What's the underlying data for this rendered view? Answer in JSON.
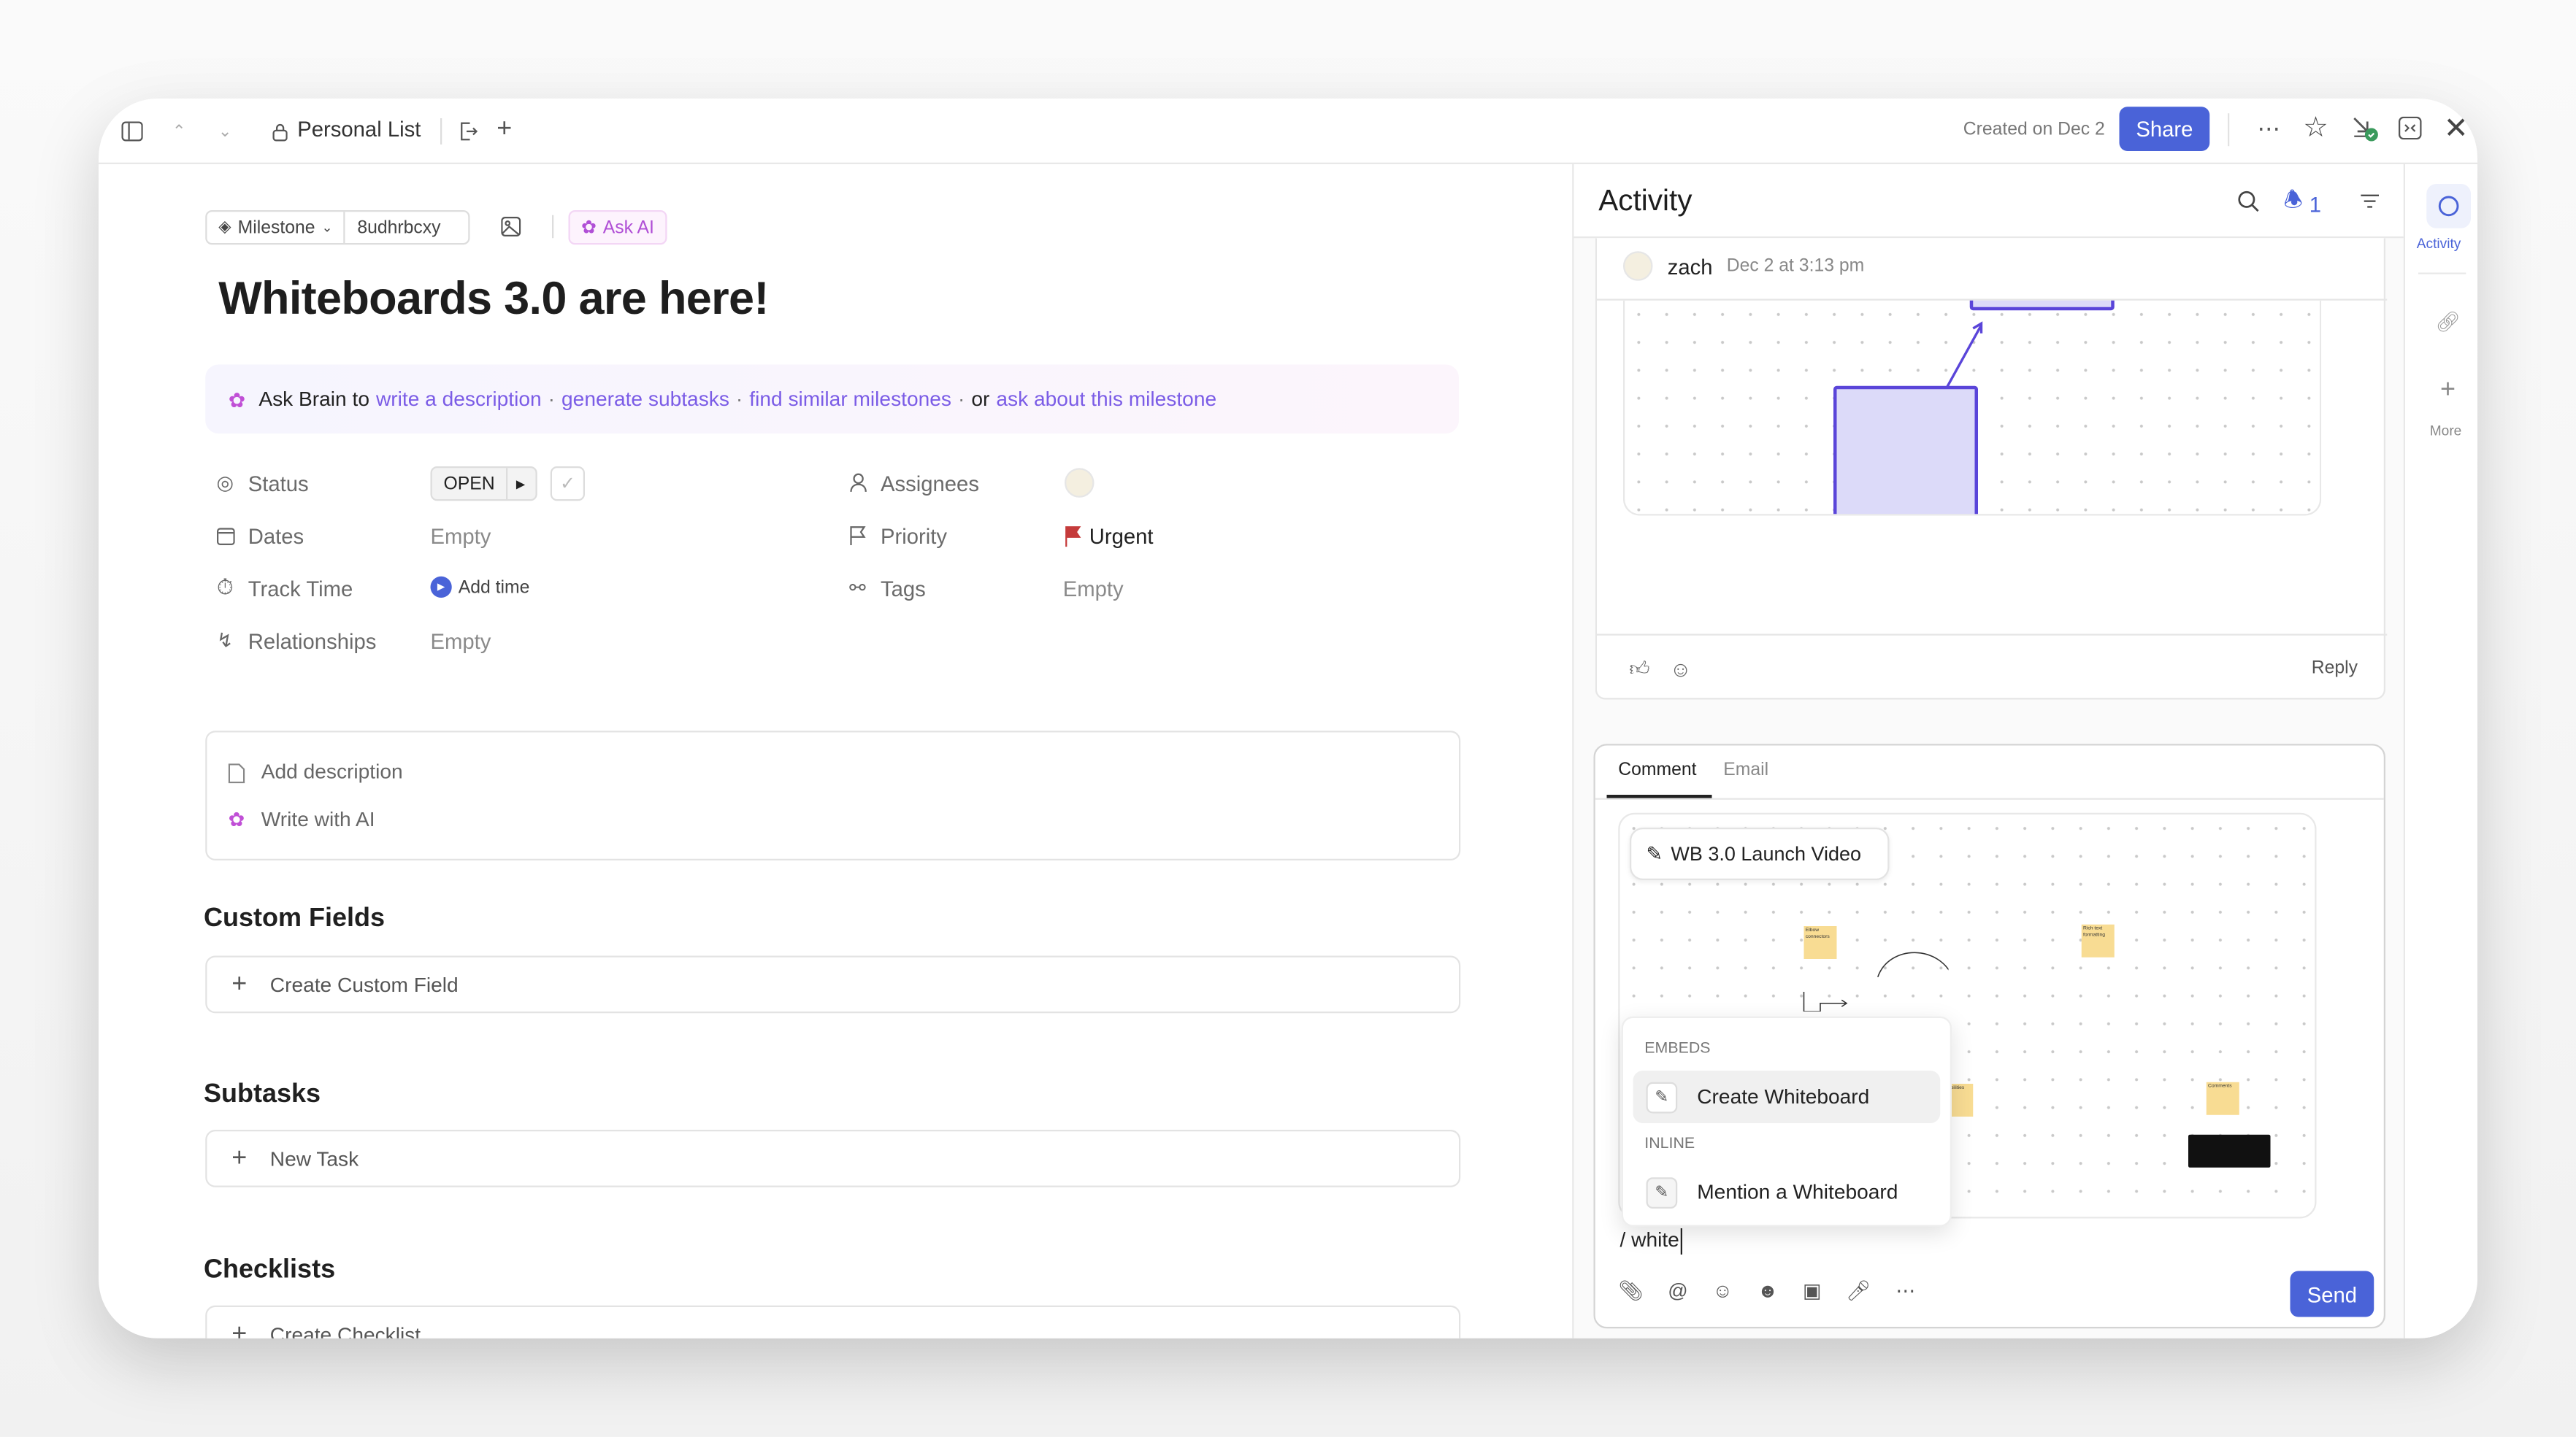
{
  "topbar": {
    "breadcrumb": "Personal List",
    "created": "Created on Dec 2",
    "share_label": "Share"
  },
  "task": {
    "type_label": "Milestone",
    "task_id": "8udhrbcxy",
    "ask_ai_label": "Ask AI",
    "title": "Whiteboards 3.0 are here!",
    "ask_brain": {
      "prefix": "Ask Brain to",
      "actions": [
        "write a description",
        "generate subtasks",
        "find similar milestones"
      ],
      "or": "or",
      "last_action": "ask about this milestone",
      "sep": "·"
    },
    "fields": {
      "status": {
        "label": "Status",
        "value": "OPEN"
      },
      "dates": {
        "label": "Dates",
        "value": "Empty"
      },
      "track_time": {
        "label": "Track Time",
        "value": "Add time"
      },
      "relationships": {
        "label": "Relationships",
        "value": "Empty"
      },
      "assignees": {
        "label": "Assignees"
      },
      "priority": {
        "label": "Priority",
        "value": "Urgent",
        "color": "#c53b3b"
      },
      "tags": {
        "label": "Tags",
        "value": "Empty"
      }
    },
    "description": {
      "add": "Add description",
      "ai": "Write with AI"
    },
    "custom_fields": {
      "heading": "Custom Fields",
      "action": "Create Custom Field"
    },
    "subtasks": {
      "heading": "Subtasks",
      "action": "New Task"
    },
    "checklists": {
      "heading": "Checklists",
      "action": "Create Checklist"
    }
  },
  "activity": {
    "title": "Activity",
    "notification_count": "1",
    "comment": {
      "author": "zach",
      "time": "Dec 2 at 3:13 pm",
      "reply": "Reply"
    },
    "composer": {
      "tabs": [
        "Comment",
        "Email"
      ],
      "active_tab": "Comment",
      "embed_title": "WB 3.0 Launch Video",
      "stickies": [
        "Elbow connectors",
        "Rich text formatting",
        "AI abilities",
        "Comments"
      ],
      "menu": {
        "section1": "EMBEDS",
        "item1": "Create Whiteboard",
        "section2": "INLINE",
        "item2": "Mention a Whiteboard"
      },
      "input_value": "/ white",
      "send_label": "Send"
    }
  },
  "rail": {
    "activity_label": "Activity",
    "more_label": "More"
  },
  "colors": {
    "accent": "#4a63d8",
    "ai": "#b04fd6",
    "whiteboard_shape": "#dcdaf9",
    "whiteboard_stroke": "#5a45d9",
    "sticky": "#f8dc93"
  }
}
